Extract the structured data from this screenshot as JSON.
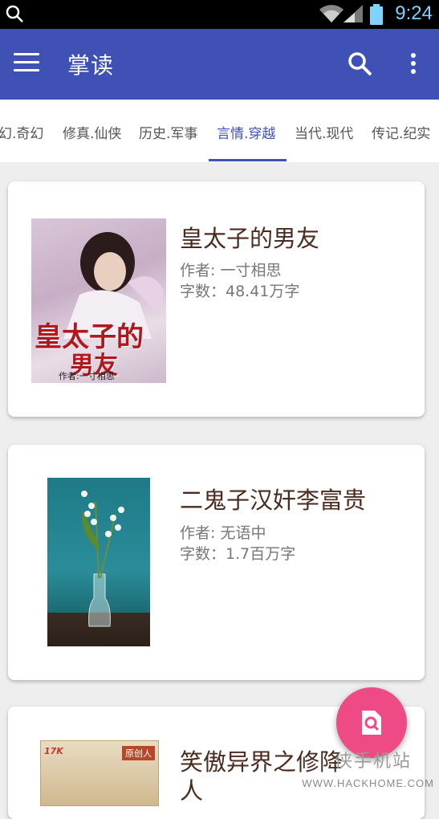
{
  "status_bar": {
    "time": "9:24",
    "icons": [
      "search-icon",
      "wifi-icon",
      "signal-icon",
      "battery-icon"
    ]
  },
  "app_bar": {
    "title": "掌读",
    "icons": [
      "menu-icon",
      "search-icon",
      "more-vert-icon"
    ]
  },
  "tabs": [
    {
      "label": "幻.奇幻"
    },
    {
      "label": "修真.仙侠"
    },
    {
      "label": "历史.军事"
    },
    {
      "label": "言情.穿越",
      "active": true
    },
    {
      "label": "当代.现代"
    },
    {
      "label": "传记.纪实"
    }
  ],
  "books": [
    {
      "title": "皇太子的男友",
      "author": "作者: 一寸相思",
      "words": "字数：48.41万字",
      "cover_text": "皇太子的",
      "cover_text2": "男友",
      "cover_author": "作者:一寸相思"
    },
    {
      "title": "二鬼子汉奸李富贵",
      "author": "作者: 无语中",
      "words": "字数：1.7百万字"
    },
    {
      "title": "笑傲异界之修降",
      "title_line2": "人",
      "cover_badge_left": "17K",
      "cover_badge_right": "原创人"
    }
  ],
  "watermark": {
    "text": "WWW.HACKHOME.COM",
    "cn": "侠手机站"
  },
  "colors": {
    "primary": "#3f51b5",
    "accent": "#ee4b86",
    "title_text": "#4a2b1f"
  }
}
